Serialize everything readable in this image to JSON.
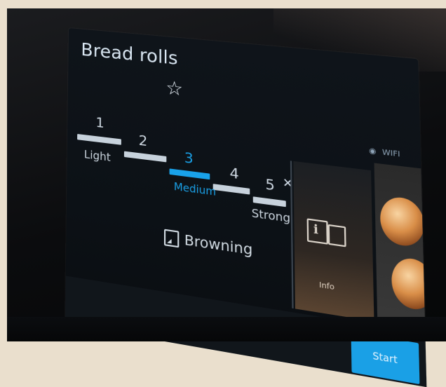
{
  "screen": {
    "title": "Bread rolls",
    "wifi_label": "WIFI",
    "start_label": "Start",
    "info_label": "Info"
  },
  "browning": {
    "label": "Browning",
    "levels": [
      "1",
      "2",
      "3",
      "4",
      "5"
    ],
    "selected_level": "3",
    "low_label": "Light",
    "mid_label": "Medium",
    "high_label": "Strong"
  },
  "icons": {
    "favorite": "star-icon",
    "close": "close-icon",
    "wifi": "wifi-icon",
    "browning": "browning-icon",
    "info": "info-icon"
  },
  "colors": {
    "accent": "#1aa0e6",
    "inactive_segment": "#c7d2dc",
    "background": "#0c1116"
  }
}
